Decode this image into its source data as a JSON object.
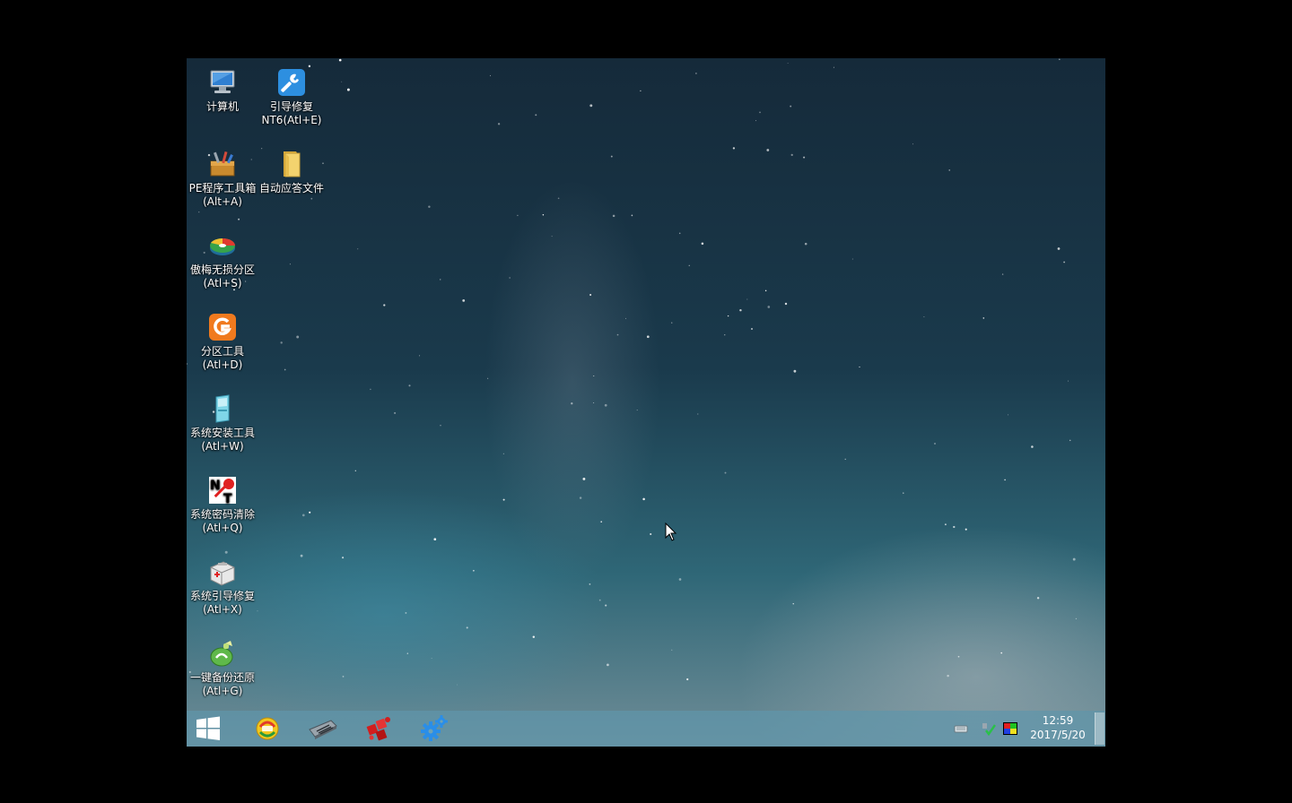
{
  "desktop": {
    "icons": [
      {
        "id": "computer",
        "line1": "计算机",
        "line2": "",
        "icon": "computer-icon"
      },
      {
        "id": "boot-repair-nt6",
        "line1": "引导修复",
        "line2": "NT6(Atl+E)",
        "icon": "wrench-icon"
      },
      {
        "id": "pe-toolbox",
        "line1": "PE程序工具箱",
        "line2": "(Alt+A)",
        "icon": "toolbox-icon"
      },
      {
        "id": "auto-answer",
        "line1": "自动应答文件",
        "line2": "",
        "icon": "folder-icon"
      },
      {
        "id": "partition-assistant",
        "line1": "傲梅无损分区",
        "line2": "(Atl+S)",
        "icon": "disk-pie-icon"
      },
      {
        "id": "partition-tool",
        "line1": "分区工具",
        "line2": "(Atl+D)",
        "icon": "diskgenius-icon"
      },
      {
        "id": "system-install",
        "line1": "系统安装工具",
        "line2": "(Atl+W)",
        "icon": "installer-icon"
      },
      {
        "id": "password-clear",
        "line1": "系统密码清除",
        "line2": "(Atl+Q)",
        "icon": "nt-password-icon"
      },
      {
        "id": "boot-fix",
        "line1": "系统引导修复",
        "line2": "(Atl+X)",
        "icon": "first-aid-kit-icon"
      },
      {
        "id": "backup-restore",
        "line1": "一键备份还原",
        "line2": "(Atl+G)",
        "icon": "ghost-restore-icon"
      }
    ]
  },
  "taskbar": {
    "start_icon": "windows-logo-icon",
    "pinned": [
      "winpe-tool-icon",
      "memory-module-icon",
      "red-puzzle-icon",
      "gears-icon"
    ],
    "tray": [
      "keyboard-icon",
      "network-check-icon",
      "color-display-icon"
    ],
    "clock": {
      "time": "12:59",
      "date": "2017/5/20"
    }
  }
}
